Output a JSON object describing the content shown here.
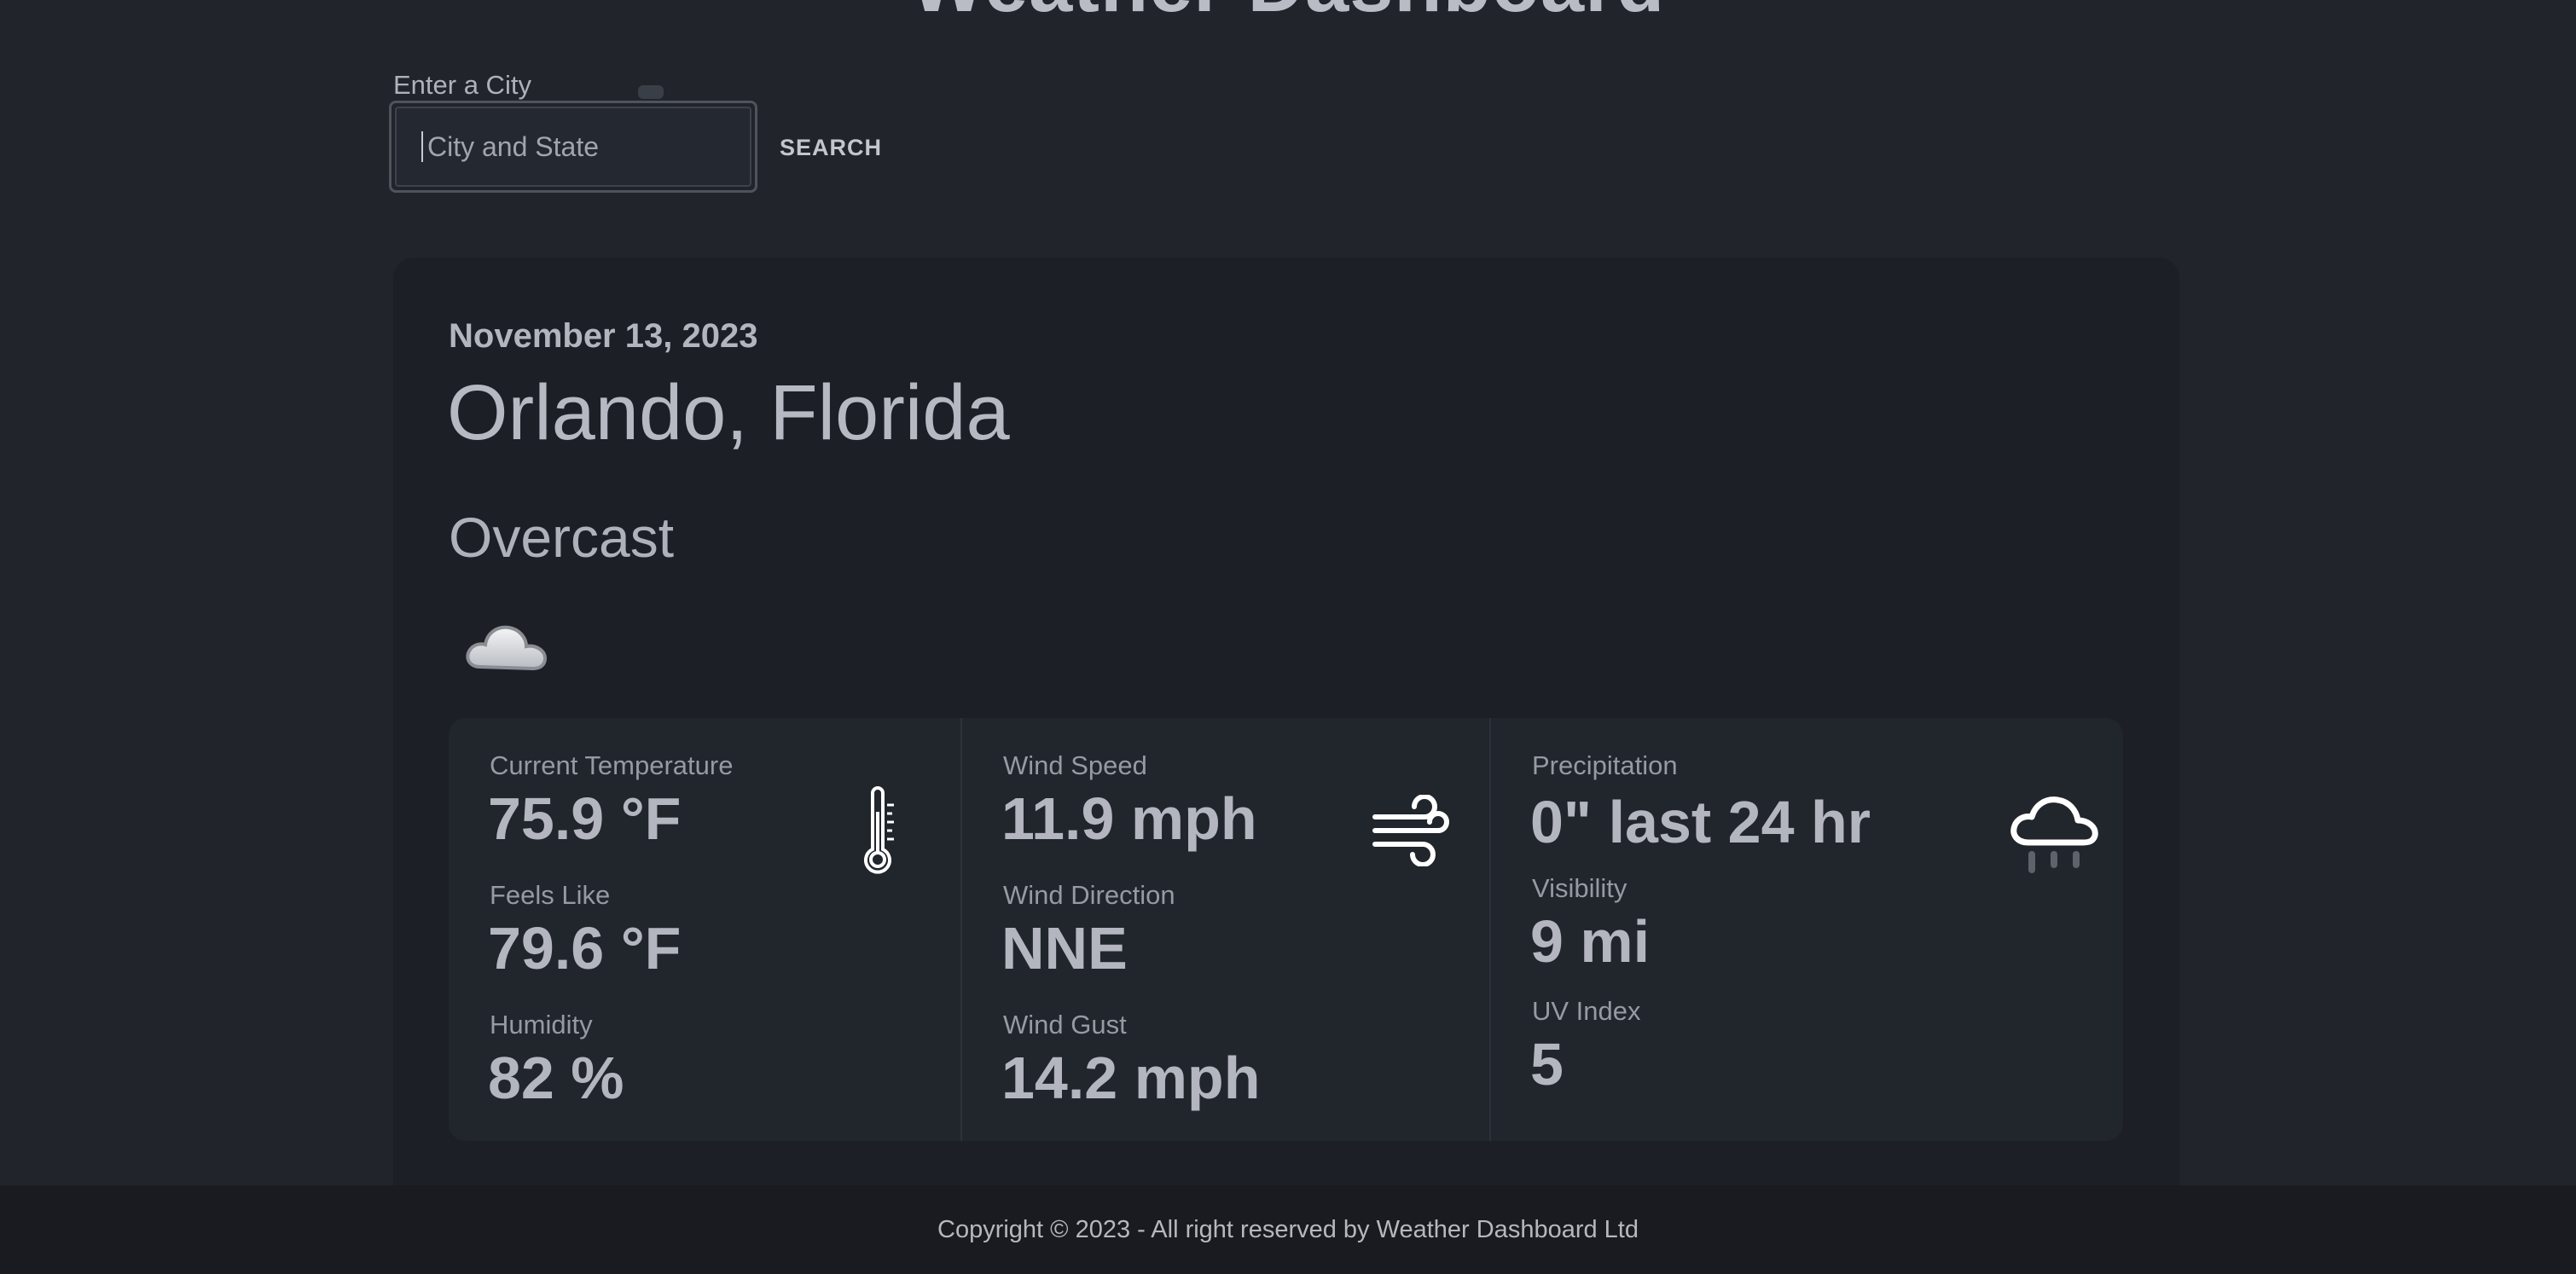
{
  "app": {
    "title": "Weather Dashboard"
  },
  "search": {
    "label": "Enter a City",
    "placeholder": "City and State",
    "value": "",
    "button_label": "SEARCH"
  },
  "current": {
    "date": "November 13, 2023",
    "location": "Orlando, Florida",
    "condition": "Overcast",
    "condition_icon": "cloud-icon"
  },
  "stats": {
    "temperature": {
      "icon": "thermometer-icon",
      "current_label": "Current Temperature",
      "current_value": "75.9 °F",
      "feels_label": "Feels Like",
      "feels_value": "79.6 °F",
      "humidity_label": "Humidity",
      "humidity_value": "82 %"
    },
    "wind": {
      "icon": "wind-icon",
      "speed_label": "Wind Speed",
      "speed_value": "11.9 mph",
      "direction_label": "Wind Direction",
      "direction_value": "NNE",
      "gust_label": "Wind Gust",
      "gust_value": "14.2 mph"
    },
    "precip": {
      "icon": "rain-cloud-icon",
      "precip_label": "Precipitation",
      "precip_value": "0\" last 24 hr",
      "visibility_label": "Visibility",
      "visibility_value": "9 mi",
      "uv_label": "UV Index",
      "uv_value": "5"
    }
  },
  "footer": {
    "text": "Copyright © 2023 - All right reserved by Weather Dashboard Ltd"
  },
  "colors": {
    "page_background": "#21242b",
    "card_background": "#1c1f25",
    "panel_background": "#21252c",
    "footer_background": "#191b20",
    "text_primary": "#b3b6be",
    "text_muted": "#959aa3"
  }
}
